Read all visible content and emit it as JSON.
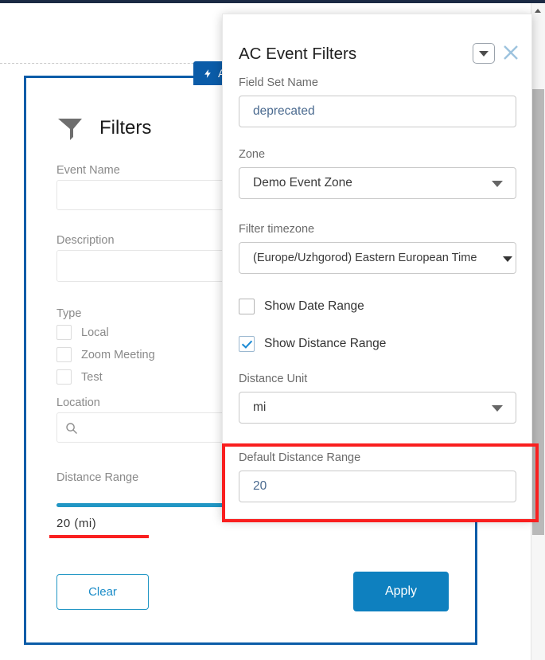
{
  "lightning_tab": {
    "label": "A",
    "icon": "lightning-bolt-icon"
  },
  "filters_panel": {
    "title": "Filters",
    "icon": "funnel-icon",
    "fields": {
      "event_name_label": "Event Name",
      "event_name_value": "",
      "description_label": "Description",
      "description_value": "",
      "type_label": "Type",
      "type_options": [
        {
          "label": "Local",
          "checked": false
        },
        {
          "label": "Zoom Meeting",
          "checked": false
        },
        {
          "label": "Test",
          "checked": false
        }
      ],
      "location_label": "Location",
      "location_value": "",
      "location_icon": "search-icon",
      "distance_range_label": "Distance Range",
      "distance_range_value": "20  (mi)",
      "distance_slider_percent": 45
    },
    "buttons": {
      "clear_label": "Clear",
      "apply_label": "Apply"
    }
  },
  "dialog": {
    "title": "AC Event Filters",
    "caret_icon": "chevron-down-icon",
    "close_icon": "close-icon",
    "field_set_name_label": "Field Set Name",
    "field_set_name_value": "deprecated",
    "zone_label": "Zone",
    "zone_value": "Demo Event Zone",
    "filter_timezone_label": "Filter timezone",
    "filter_timezone_value": "(Europe/Uzhgorod) Eastern European Time",
    "show_date_range_label": "Show Date Range",
    "show_date_range_checked": false,
    "show_distance_range_label": "Show Distance Range",
    "show_distance_range_checked": true,
    "distance_unit_label": "Distance Unit",
    "distance_unit_value": "mi",
    "default_distance_range_label": "Default Distance Range",
    "default_distance_range_value": "20"
  },
  "annotations": {
    "highlight_color": "#f91f1f",
    "box_target": "default-distance-range-field",
    "underline_target": "distance-range-value"
  },
  "colors": {
    "panel_border": "#0b5ca8",
    "apply_button": "#0e80bf",
    "slider": "#2196c4",
    "tab": "#0b5ca8"
  }
}
